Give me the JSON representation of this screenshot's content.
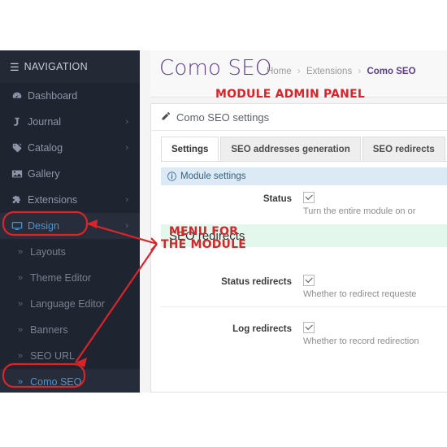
{
  "window": {
    "background": "#ffffff"
  },
  "sidebar": {
    "header": {
      "label": "NAVIGATION",
      "icon": "hamburger-icon"
    },
    "items": [
      {
        "label": "Dashboard",
        "icon": "dashboard-gauge-icon",
        "caret": "",
        "active": false
      },
      {
        "label": "Journal",
        "icon": "journal-j-icon",
        "caret": "›",
        "active": false
      },
      {
        "label": "Catalog",
        "icon": "tag-icon",
        "caret": "›",
        "active": false
      },
      {
        "label": "Gallery",
        "icon": "image-icon",
        "caret": "",
        "active": false
      },
      {
        "label": "Extensions",
        "icon": "puzzle-piece-icon",
        "caret": "›",
        "active": false
      },
      {
        "label": "Design",
        "icon": "monitor-icon",
        "caret": "›",
        "active": true
      }
    ],
    "subitems": [
      {
        "label": "Layouts",
        "chevron": "»",
        "current": false
      },
      {
        "label": "Theme Editor",
        "chevron": "»",
        "current": false
      },
      {
        "label": "Language Editor",
        "chevron": "»",
        "current": false
      },
      {
        "label": "Banners",
        "chevron": "»",
        "current": false
      },
      {
        "label": "SEO URL",
        "chevron": "»",
        "current": false
      },
      {
        "label": "Como SEO",
        "chevron": "»",
        "current": true
      }
    ]
  },
  "header": {
    "title": "Como SEO",
    "breadcrumb": [
      {
        "label": "Home",
        "last": false
      },
      {
        "label": "Extensions",
        "last": false
      },
      {
        "label": "Como SEO",
        "last": true
      }
    ],
    "breadcrumb_separator": "›"
  },
  "panel": {
    "icon": "pencil-icon",
    "title": "Como SEO settings",
    "tabs": [
      {
        "label": "Settings",
        "active": true
      },
      {
        "label": "SEO addresses generation",
        "active": false
      },
      {
        "label": "SEO redirects",
        "active": false
      },
      {
        "label": "",
        "active": false
      }
    ],
    "info_strip": {
      "icon": "info-circle-icon",
      "label": "Module settings"
    },
    "fields": [
      {
        "label": "Status",
        "checked": true,
        "help": "Turn the entire module on or"
      },
      {
        "label": "Status redirects",
        "checked": true,
        "help": "Whether to redirect requeste"
      },
      {
        "label": "Log redirects",
        "checked": true,
        "help": "Whether to record redirection"
      }
    ],
    "section_banner": "SEO redirects"
  },
  "annotations": {
    "top_note": "MODULE ADMIN PANEL",
    "menu_note": "MENU FOR THE MODULE",
    "color": "#d9242a"
  }
}
